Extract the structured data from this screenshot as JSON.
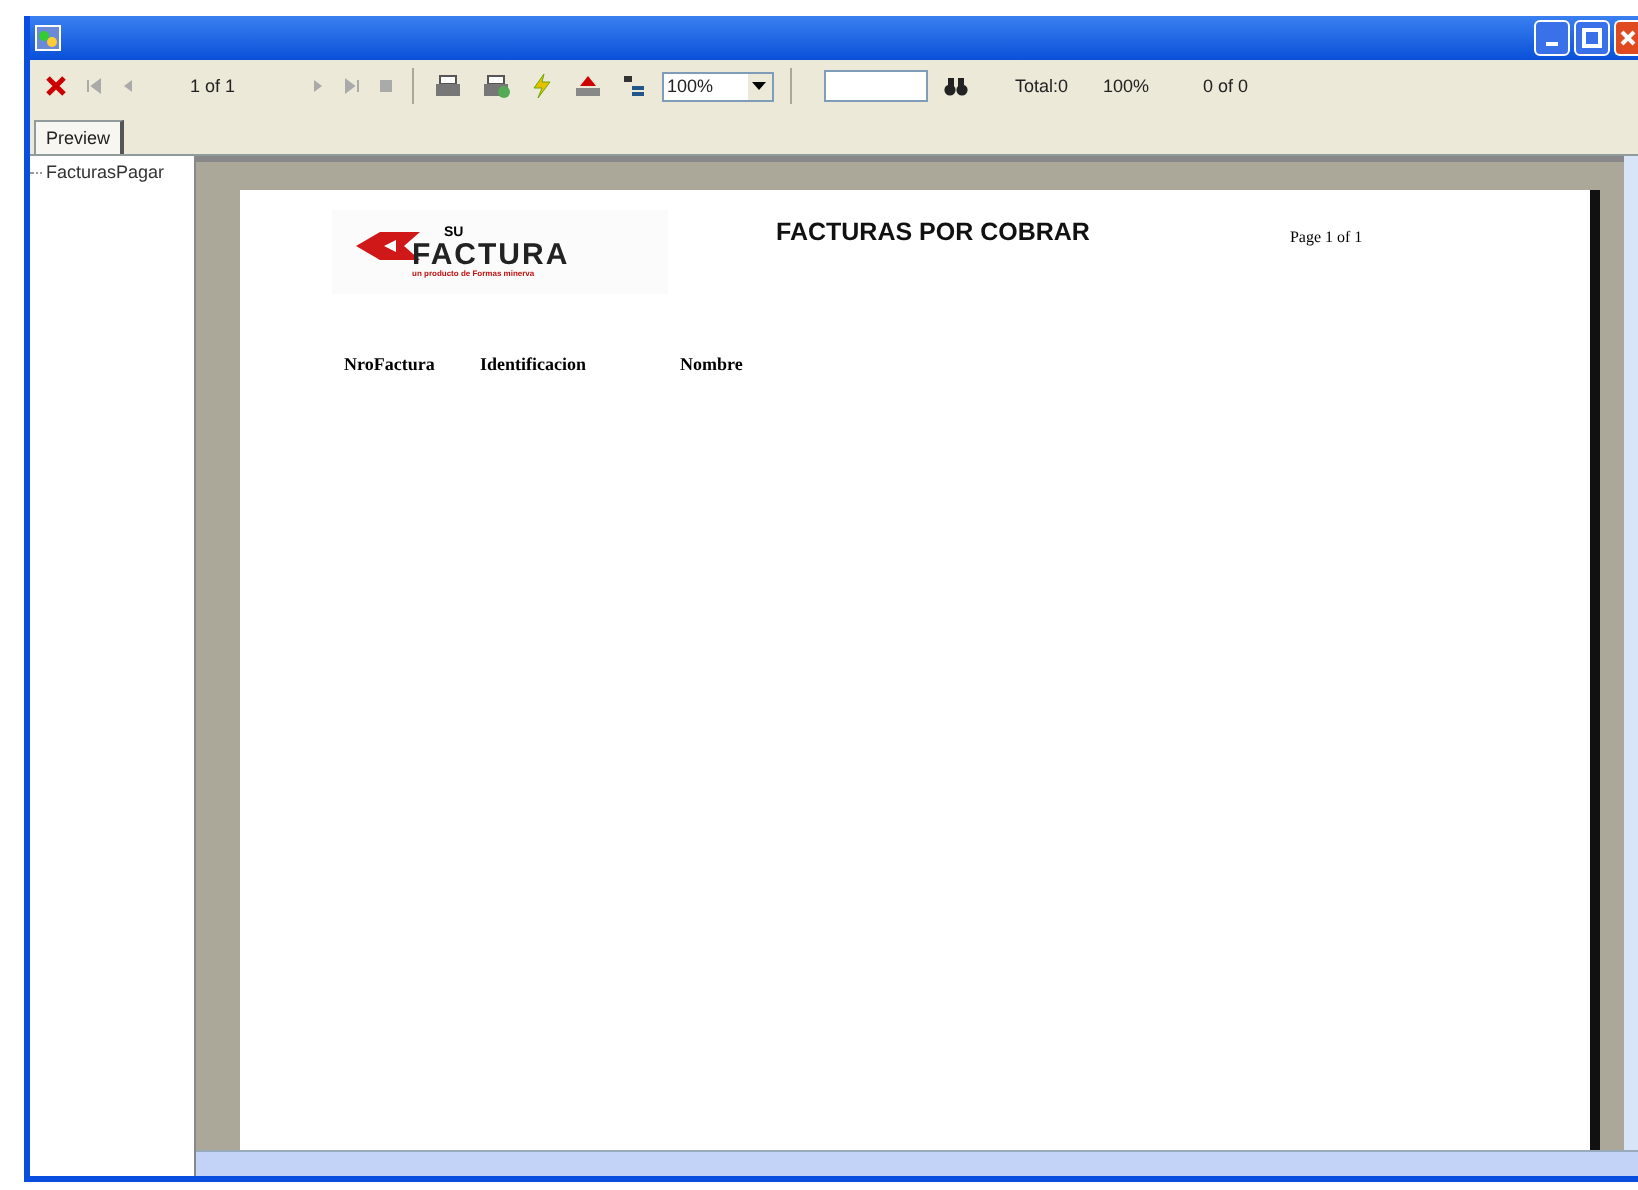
{
  "toolbar": {
    "page_indicator": "1 of 1",
    "zoom": "100%",
    "search": {
      "kind": "field"
    },
    "total": "Total:0",
    "percent": "100%",
    "matches": "0 of 0"
  },
  "tabs": [
    {
      "label": "Preview",
      "selected": true
    }
  ],
  "tree": {
    "items": [
      {
        "label": "FacturasPagar",
        "selected": false
      }
    ]
  },
  "report": {
    "logo": {
      "top": "SU",
      "main": "FACTURA",
      "tagline": "un producto de Formas minerva"
    },
    "title": "FACTURAS POR COBRAR",
    "page": "Page 1 of 1",
    "columns": [
      "NroFactura",
      "Identificacion",
      "Nombre"
    ]
  }
}
